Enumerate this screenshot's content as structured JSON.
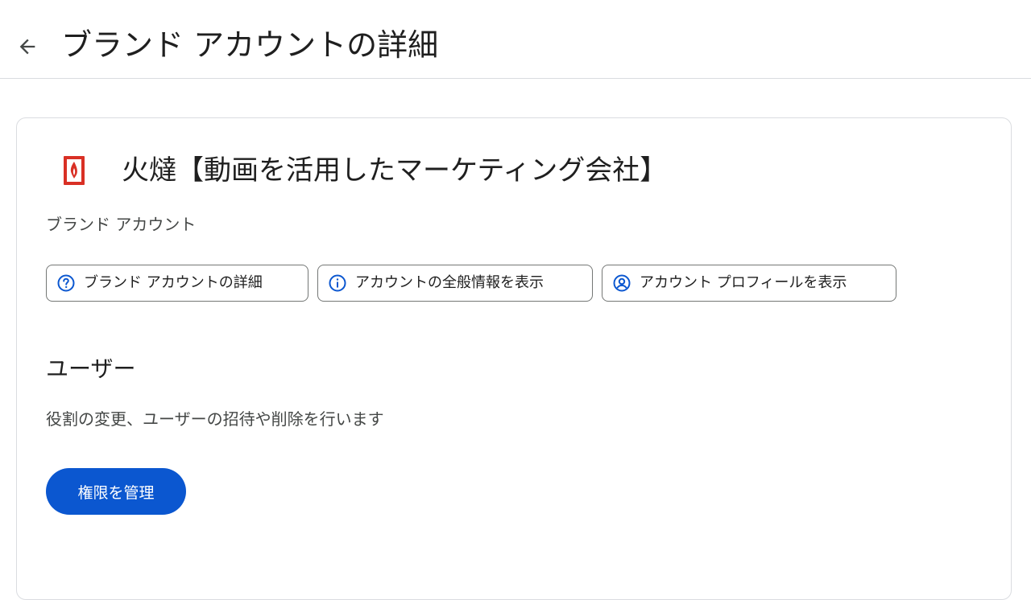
{
  "header": {
    "title": "ブランド アカウントの詳細",
    "back_icon": "arrow-back-icon"
  },
  "brand": {
    "name": "火燵【動画を活用したマーケティング会社】",
    "type_label": "ブランド アカウント",
    "logo_icon": "flame-logo-icon",
    "logo_color": "#d93025"
  },
  "chips": [
    {
      "label": "ブランド アカウントの詳細",
      "icon": "help-circle-icon"
    },
    {
      "label": "アカウントの全般情報を表示",
      "icon": "info-circle-icon"
    },
    {
      "label": "アカウント プロフィールを表示",
      "icon": "account-circle-icon"
    }
  ],
  "users_section": {
    "title": "ユーザー",
    "description": "役割の変更、ユーザーの招待や削除を行います",
    "manage_button_label": "権限を管理"
  },
  "colors": {
    "accent": "#0b57d0",
    "border": "#dadce0",
    "icon_blue": "#0b57d0"
  }
}
